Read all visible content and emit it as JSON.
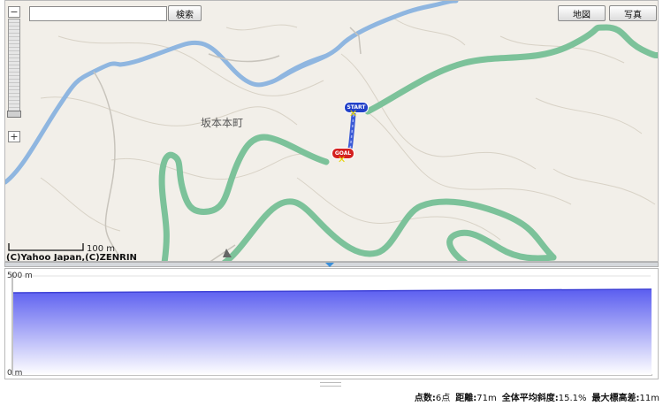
{
  "toolbar": {
    "search_placeholder": "",
    "search_button": "検索",
    "map_button": "地図",
    "photo_button": "写真"
  },
  "zoom": {
    "plus": "+",
    "minus": "−"
  },
  "map": {
    "town_label": "坂本本町",
    "scale_label": "100 m",
    "copyright": "(C)Yahoo Japan,(C)ZENRIN",
    "start_label": "START",
    "goal_label": "GOAL",
    "colors": {
      "road": "#7cc29a",
      "river": "#8fb6e0",
      "route": "#3c5bd6"
    }
  },
  "profile": {
    "y_max_label": "500 m",
    "y_min_label": "0 m",
    "fill_top": "#5b5ef0",
    "fill_bottom": "#ffffff"
  },
  "status": {
    "points_label": "点数:",
    "points_value": "6点",
    "distance_label": "距離:",
    "distance_value": "71m",
    "slope_label": "全体平均斜度:",
    "slope_value": "15.1%",
    "elev_label": "最大標高差:",
    "elev_value": "11m"
  }
}
